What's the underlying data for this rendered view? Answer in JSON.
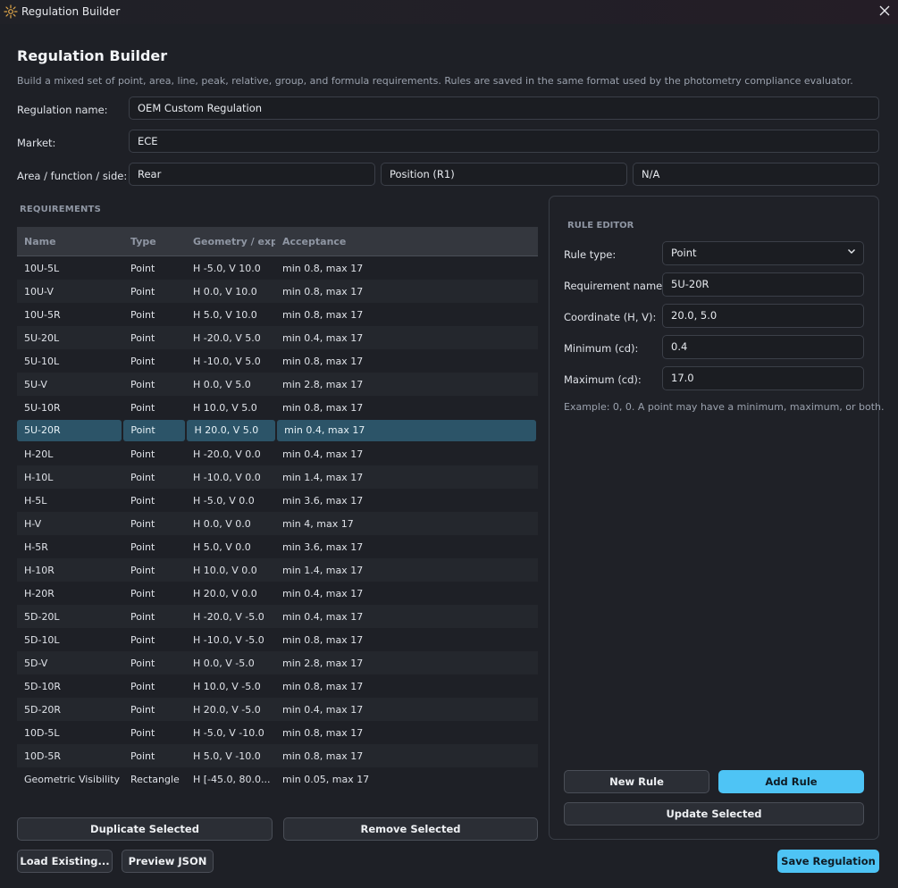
{
  "window": {
    "title": "Regulation Builder",
    "app_icon": "sun-icon",
    "close_icon": "close-icon"
  },
  "header": {
    "title": "Regulation Builder",
    "subtitle": "Build a mixed set of point, area, line, peak, relative, group, and formula requirements. Rules are saved in the same format used by the photometry compliance evaluator."
  },
  "form": {
    "name_label": "Regulation name:",
    "name_value": "OEM Custom Regulation",
    "market_label": "Market:",
    "market_value": "ECE",
    "area_label": "Area / function / side:",
    "area_value": "Rear",
    "function_value": "Position (R1)",
    "side_value": "N/A"
  },
  "requirements": {
    "section_label": "REQUIREMENTS",
    "columns": [
      "Name",
      "Type",
      "Geometry / expr",
      "Acceptance"
    ],
    "rows": [
      [
        "10U-5L",
        "Point",
        "H -5.0, V 10.0",
        "min 0.8, max 17"
      ],
      [
        "10U-V",
        "Point",
        "H 0.0, V 10.0",
        "min 0.8, max 17"
      ],
      [
        "10U-5R",
        "Point",
        "H 5.0, V 10.0",
        "min 0.8, max 17"
      ],
      [
        "5U-20L",
        "Point",
        "H -20.0, V 5.0",
        "min 0.4, max 17"
      ],
      [
        "5U-10L",
        "Point",
        "H -10.0, V 5.0",
        "min 0.8, max 17"
      ],
      [
        "5U-V",
        "Point",
        "H 0.0, V 5.0",
        "min 2.8, max 17"
      ],
      [
        "5U-10R",
        "Point",
        "H 10.0, V 5.0",
        "min 0.8, max 17"
      ],
      [
        "5U-20R",
        "Point",
        "H 20.0, V 5.0",
        "min 0.4, max 17"
      ],
      [
        "H-20L",
        "Point",
        "H -20.0, V 0.0",
        "min 0.4, max 17"
      ],
      [
        "H-10L",
        "Point",
        "H -10.0, V 0.0",
        "min 1.4, max 17"
      ],
      [
        "H-5L",
        "Point",
        "H -5.0, V 0.0",
        "min 3.6, max 17"
      ],
      [
        "H-V",
        "Point",
        "H 0.0, V 0.0",
        "min 4, max 17"
      ],
      [
        "H-5R",
        "Point",
        "H 5.0, V 0.0",
        "min 3.6, max 17"
      ],
      [
        "H-10R",
        "Point",
        "H 10.0, V 0.0",
        "min 1.4, max 17"
      ],
      [
        "H-20R",
        "Point",
        "H 20.0, V 0.0",
        "min 0.4, max 17"
      ],
      [
        "5D-20L",
        "Point",
        "H -20.0, V -5.0",
        "min 0.4, max 17"
      ],
      [
        "5D-10L",
        "Point",
        "H -10.0, V -5.0",
        "min 0.8, max 17"
      ],
      [
        "5D-V",
        "Point",
        "H 0.0, V -5.0",
        "min 2.8, max 17"
      ],
      [
        "5D-10R",
        "Point",
        "H 10.0, V -5.0",
        "min 0.8, max 17"
      ],
      [
        "5D-20R",
        "Point",
        "H 20.0, V -5.0",
        "min 0.4, max 17"
      ],
      [
        "10D-5L",
        "Point",
        "H -5.0, V -10.0",
        "min 0.8, max 17"
      ],
      [
        "10D-5R",
        "Point",
        "H 5.0, V -10.0",
        "min 0.8, max 17"
      ],
      [
        "Geometric Visibility",
        "Rectangle",
        "H [-45.0, 80.0...",
        "min 0.05, max 17"
      ]
    ],
    "selected_row": "5U-20R"
  },
  "buttons": {
    "duplicate": "Duplicate Selected",
    "remove": "Remove Selected",
    "load": "Load Existing...",
    "preview": "Preview JSON",
    "save": "Save Regulation"
  },
  "editor": {
    "title": "RULE EDITOR",
    "rule_type_label": "Rule type:",
    "rule_type_value": "Point",
    "req_name_label": "Requirement name:",
    "req_name_value": "5U-20R",
    "coord_label": "Coordinate (H, V):",
    "coord_value": "20.0, 5.0",
    "min_label": "Minimum (cd):",
    "min_value": "0.4",
    "max_label": "Maximum (cd):",
    "max_value": "17.0",
    "hint": "Example: 0, 0. A point may have a minimum, maximum, or both.",
    "new_rule": "New Rule",
    "add_rule": "Add Rule",
    "update_selected": "Update Selected"
  },
  "colors": {
    "accent": "#4ec4f5",
    "selection": "#2c5468",
    "background": "#1e2026"
  }
}
